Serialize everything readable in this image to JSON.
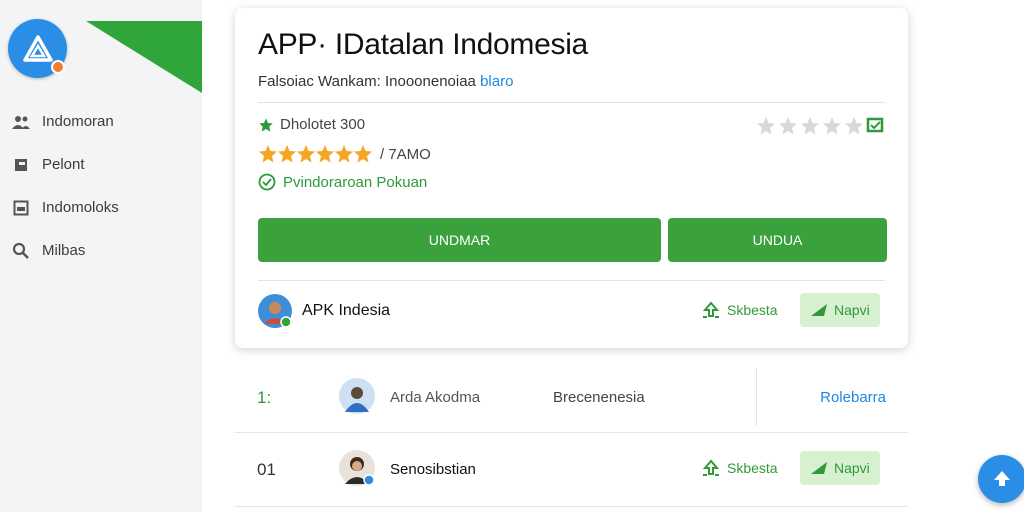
{
  "sidebar": {
    "items": [
      {
        "label": "Indomoran",
        "icon": "people-icon"
      },
      {
        "label": "Pelont",
        "icon": "flag-icon"
      },
      {
        "label": "Indomoloks",
        "icon": "window-icon"
      },
      {
        "label": "Milbas",
        "icon": "search-icon"
      }
    ]
  },
  "app": {
    "title": "APP· IDatalan Indomesia",
    "subtitle_main": "Falsoiac Wankam: Inooonenoiaa",
    "subtitle_accent": "blaro",
    "downloads": "Dholotet 300",
    "rating_text": "/ 7AMO",
    "verified_text": "Pvindoraroan Pokuan",
    "buttons": {
      "primary": "UNDMAR",
      "secondary": "UNDUA"
    },
    "developer": "APK Indesia",
    "action_ghost": "Skbesta",
    "action_fill": "Napvi"
  },
  "list": [
    {
      "rank": "1:",
      "name": "Arda Akodma",
      "mid": "Brecenenesia",
      "link": "Rolebarra"
    },
    {
      "rank": "01",
      "name": "Senosibstian",
      "action_ghost": "Skbesta",
      "action_fill": "Napvi"
    }
  ],
  "colors": {
    "accent": "#2b8ee6",
    "green": "#3aa13d",
    "star": "#f5a623"
  }
}
